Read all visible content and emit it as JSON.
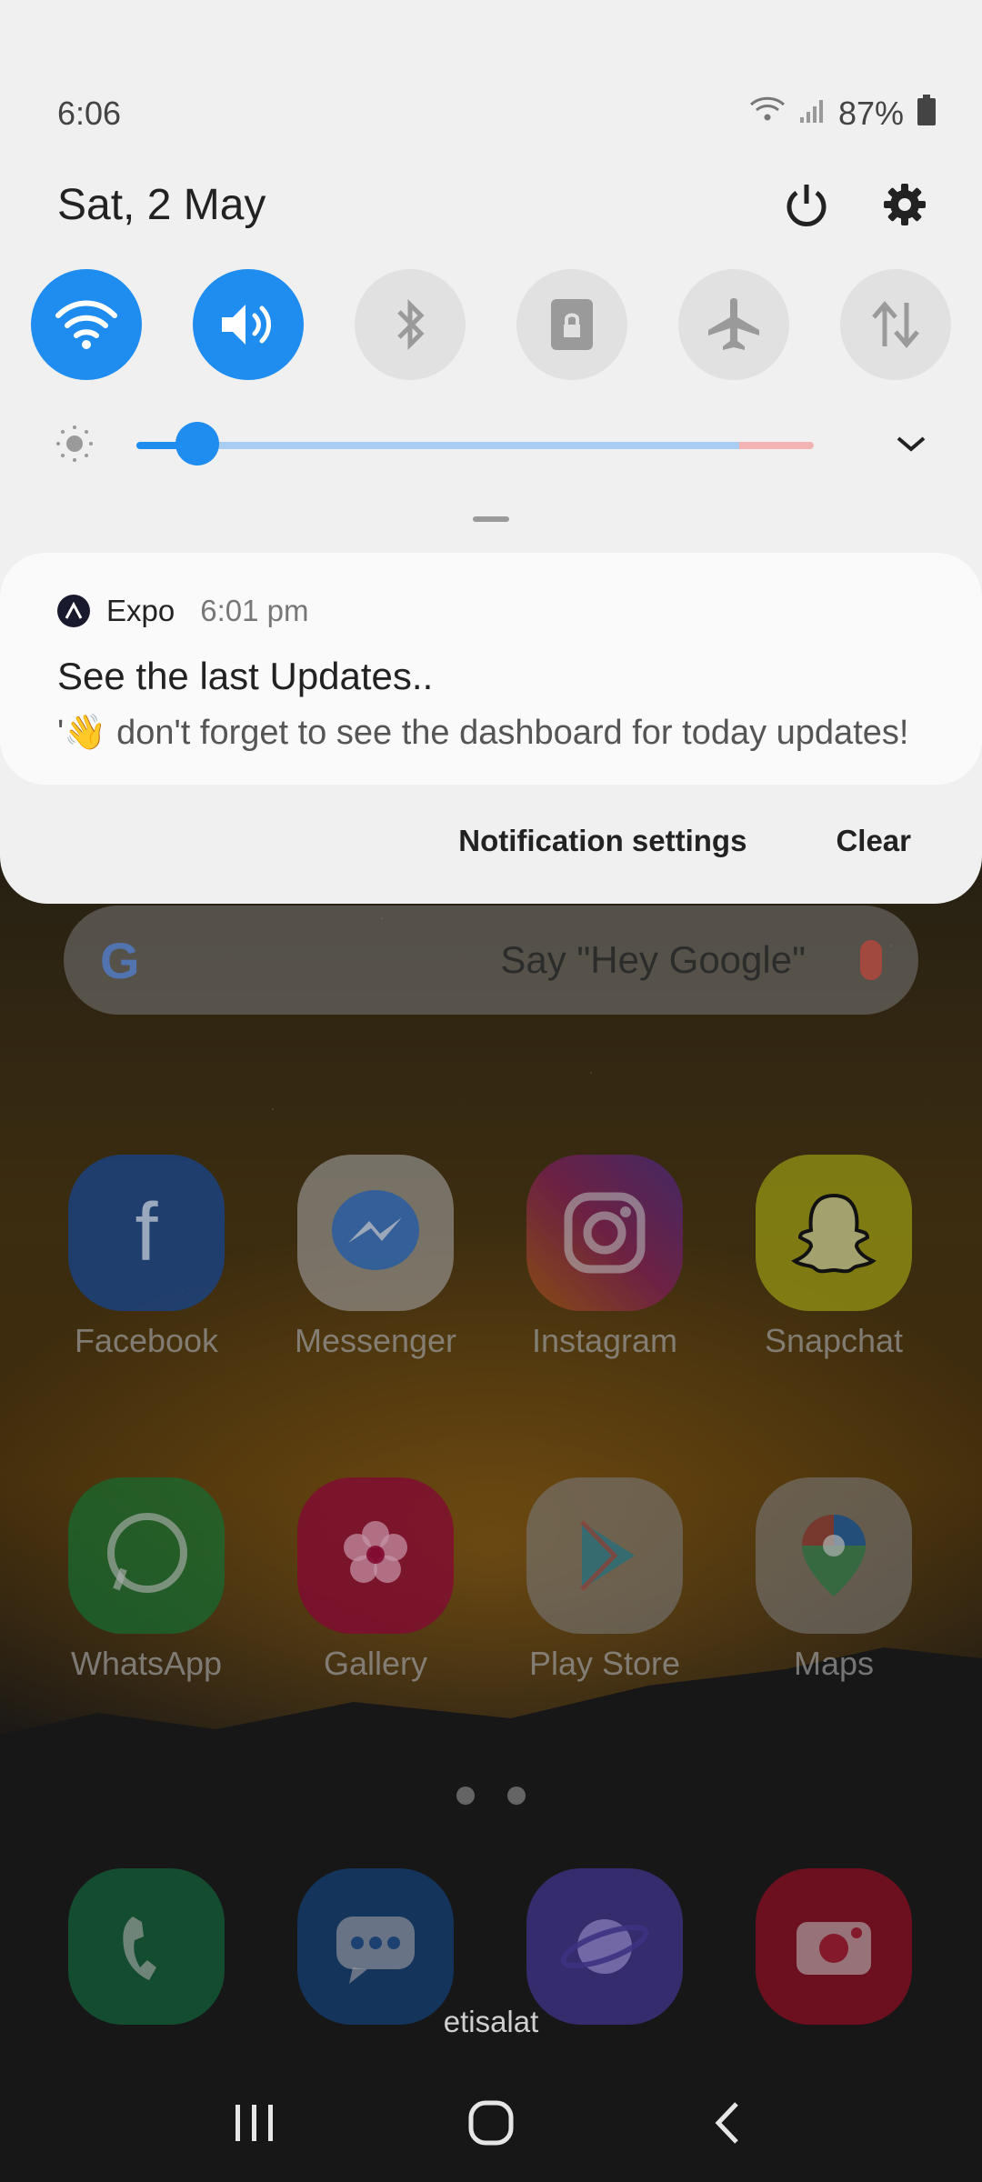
{
  "status_bar": {
    "time": "6:06",
    "battery": "87%"
  },
  "quick_panel": {
    "date": "Sat, 2 May",
    "toggles": [
      {
        "name": "wifi",
        "on": true
      },
      {
        "name": "sound",
        "on": true
      },
      {
        "name": "bluetooth",
        "on": false
      },
      {
        "name": "rotation-lock",
        "on": false
      },
      {
        "name": "airplane-mode",
        "on": false
      },
      {
        "name": "mobile-data",
        "on": false
      }
    ],
    "brightness_level": 0.09,
    "accent_color": "#1f8cf0"
  },
  "notification": {
    "app": "Expo",
    "time": "6:01 pm",
    "title": "See the last Updates..",
    "body": "'👋 don't forget to see the dashboard for today updates!"
  },
  "actions": {
    "settings_label": "Notification settings",
    "clear_label": "Clear"
  },
  "home": {
    "search_placeholder": "Say \"Hey Google\"",
    "apps_row1": [
      "Facebook",
      "Messenger",
      "Instagram",
      "Snapchat"
    ],
    "apps_row2": [
      "WhatsApp",
      "Gallery",
      "Play Store",
      "Maps"
    ],
    "carrier": "etisalat"
  }
}
